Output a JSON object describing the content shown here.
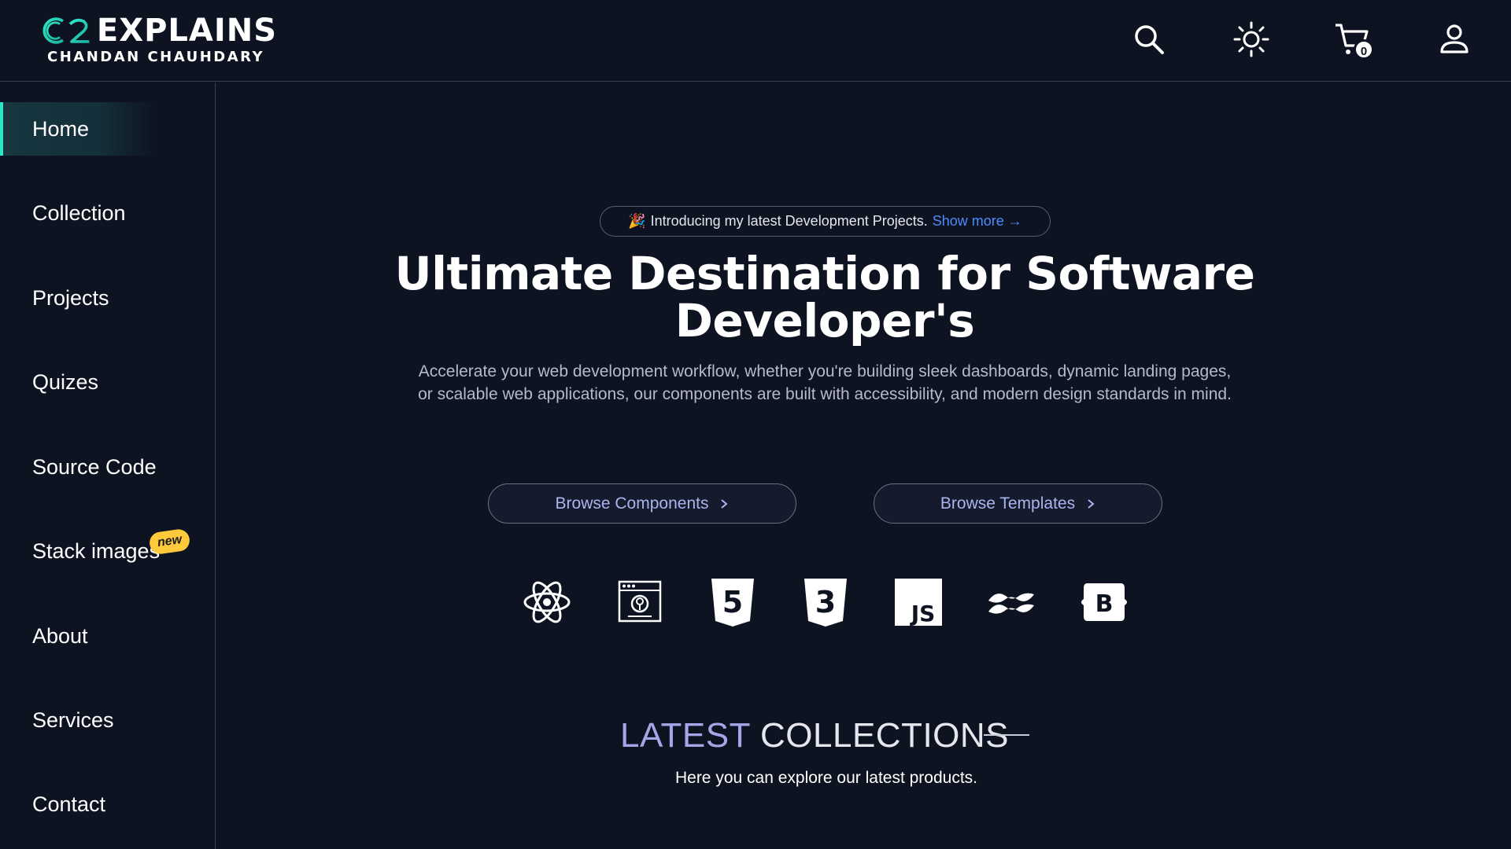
{
  "header": {
    "logo_mark": "C2",
    "logo_title": "EXPLAINS",
    "logo_subtitle": "CHANDAN CHAUHDARY",
    "cart_count": "0",
    "icons": [
      "search-icon",
      "sun-icon",
      "cart-icon",
      "user-icon"
    ]
  },
  "sidebar": {
    "items": [
      {
        "label": "Home",
        "active": true
      },
      {
        "label": "Collection"
      },
      {
        "label": "Projects"
      },
      {
        "label": "Quizes"
      },
      {
        "label": "Source Code"
      },
      {
        "label": "Stack images",
        "badge": "new"
      },
      {
        "label": "About"
      },
      {
        "label": "Services"
      },
      {
        "label": "Contact"
      }
    ]
  },
  "announcement": {
    "emoji": "🎉",
    "text": "Introducing my latest Development Projects.",
    "link": "Show more →"
  },
  "hero": {
    "title": "Ultimate Destination for Software Developer's",
    "description": "Accelerate your web development workflow, whether you're building sleek dashboards, dynamic landing pages, or scalable web applications, our components are built with accessibility, and modern design standards in mind."
  },
  "buttons": {
    "components": "Browse Components",
    "templates": "Browse Templates"
  },
  "tech_icons": [
    "react-icon",
    "web-dev-icon",
    "html5-icon",
    "css3-icon",
    "javascript-icon",
    "tailwind-icon",
    "bootstrap-icon"
  ],
  "tech_labels": {
    "html": "5",
    "css": "3",
    "js": "JS",
    "bootstrap": "B"
  },
  "latest": {
    "title_part1": "LATEST",
    "title_part2": "COLLECTIONS",
    "subtitle": "Here you can explore our latest products."
  },
  "colors": {
    "background": "#0e1322",
    "accent": "#2ee6c8",
    "link": "#4e8bff",
    "badge": "#ffc93c",
    "button_text": "#aab4ee"
  }
}
